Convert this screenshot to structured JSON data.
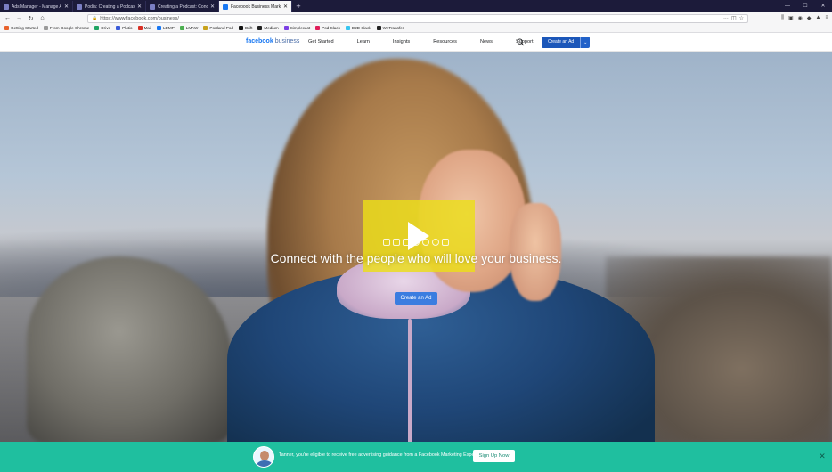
{
  "browser": {
    "tabs": [
      {
        "title": "Ads Manager - Manage Ads",
        "active": false
      },
      {
        "title": "Podia: Creating a Podcast: Conc",
        "active": false
      },
      {
        "title": "Creating a Podcast: Concept to",
        "active": false
      },
      {
        "title": "Facebook Business Marketing",
        "active": true
      }
    ],
    "new_tab_icon": "plus-icon",
    "url": "https://www.facebook.com/business/",
    "bookmarks": [
      {
        "label": "Getting Started",
        "color": "#e8622c"
      },
      {
        "label": "From Google Chrome",
        "color": "#9a9a9a"
      },
      {
        "label": "Drive",
        "color": "#1fa463"
      },
      {
        "label": "Plutio",
        "color": "#3a5bd9"
      },
      {
        "label": "Mail",
        "color": "#d93025"
      },
      {
        "label": "LDMP",
        "color": "#1877f2"
      },
      {
        "label": "LMAW",
        "color": "#4caf50"
      },
      {
        "label": "Portland Pod",
        "color": "#c8a21b"
      },
      {
        "label": "Drift",
        "color": "#111111"
      },
      {
        "label": "Medium",
        "color": "#222222"
      },
      {
        "label": "Simplecast",
        "color": "#7b3fe4"
      },
      {
        "label": "Pod Slack",
        "color": "#e01e5a"
      },
      {
        "label": "D2D Slack",
        "color": "#36c5f0"
      },
      {
        "label": "WeTransfer",
        "color": "#222222"
      }
    ]
  },
  "fb_header": {
    "brand_bold": "facebook",
    "brand_light": "business",
    "nav": [
      "Get Started",
      "Learn",
      "Insights",
      "Resources",
      "News",
      "Support"
    ],
    "create_button": "Create an Ad"
  },
  "hero": {
    "headline": "Connect with the people who will love your business.",
    "cta": "Create an Ad",
    "play_color": "#ecde19"
  },
  "banner": {
    "message": "Tanner, you're eligible to receive free advertising guidance from a Facebook Marketing Expert",
    "button": "Sign Up Now",
    "color": "#1fbf9f"
  }
}
